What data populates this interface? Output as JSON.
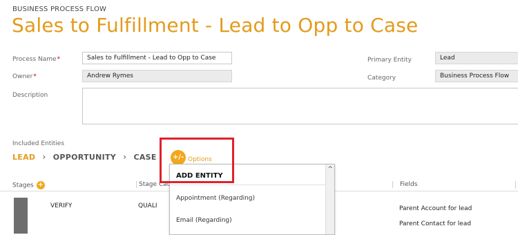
{
  "header": {
    "kicker": "BUSINESS PROCESS FLOW",
    "title": "Sales to Fulfillment - Lead to Opp to Case"
  },
  "form": {
    "process_name_label": "Process Name",
    "process_name_value": "Sales to Fulfillment - Lead to Opp to Case",
    "owner_label": "Owner",
    "owner_value": "Andrew Rymes",
    "description_label": "Description",
    "description_value": "",
    "primary_entity_label": "Primary Entity",
    "primary_entity_value": "Lead",
    "category_label": "Category",
    "category_value": "Business Process Flow",
    "required_marker": "*"
  },
  "entities": {
    "label": "Included Entities",
    "items": [
      "LEAD",
      "OPPORTUNITY",
      "CASE"
    ],
    "chevron": "›",
    "options_icon_text": "+/-",
    "options_label": "Options"
  },
  "table": {
    "stages_label": "Stages",
    "stage_category_label": "Stage Cat",
    "fields_label": "Fields",
    "row_stage": "VERIFY",
    "row_category": "QUALI",
    "fields": [
      "Parent Account for lead",
      "Parent Contact for lead"
    ]
  },
  "dropdown": {
    "header": "ADD ENTITY",
    "items": [
      "Appointment (Regarding)",
      "Email (Regarding)"
    ],
    "scroll_up": "^"
  },
  "colors": {
    "accent": "#e39b1b",
    "highlight": "#e0202c",
    "required": "#cc0000"
  }
}
